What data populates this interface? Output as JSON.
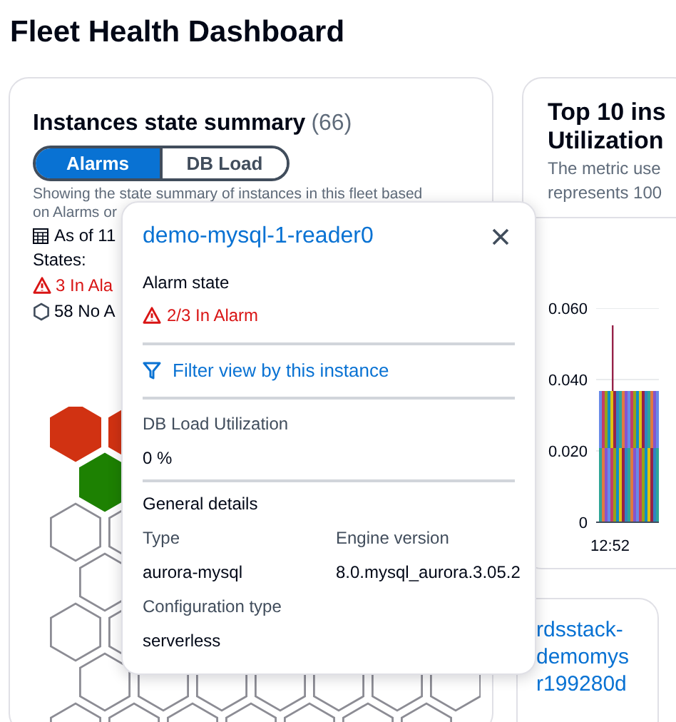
{
  "page_title": "Fleet Health Dashboard",
  "summary_card": {
    "title": "Instances state summary",
    "count": "(66)",
    "tabs": [
      {
        "label": "Alarms",
        "selected": true
      },
      {
        "label": "DB Load",
        "selected": false
      }
    ],
    "description_lines": [
      "Showing the state summary of instances in this fleet based",
      "on Alarms or"
    ],
    "as_of": "As of 11",
    "states_label": "States:",
    "states": [
      {
        "kind": "alarm",
        "text": "3 In Ala"
      },
      {
        "kind": "no_alarm",
        "text": "58 No A"
      }
    ],
    "hex_rows": [
      [
        {
          "color": "#d13212",
          "filled": true
        },
        {
          "color": "#d13212",
          "filled": true
        }
      ],
      [
        {
          "color": "#1d8102",
          "filled": true
        }
      ],
      [
        {
          "color": "#8c8c94",
          "filled": false
        },
        {
          "color": "#8c8c94",
          "filled": false
        }
      ],
      [
        {
          "color": "#8c8c94",
          "filled": false
        }
      ],
      [
        {
          "color": "#8c8c94",
          "filled": false
        },
        {
          "color": "#8c8c94",
          "filled": false
        }
      ],
      [
        {
          "color": "#8c8c94",
          "filled": false
        },
        {
          "color": "#8c8c94",
          "filled": false
        },
        {
          "color": "#8c8c94",
          "filled": false
        },
        {
          "color": "#8c8c94",
          "filled": false
        },
        {
          "color": "#8c8c94",
          "filled": false
        },
        {
          "color": "#8c8c94",
          "filled": false
        },
        {
          "color": "#8c8c94",
          "filled": false
        }
      ],
      [
        {
          "color": "#8c8c94",
          "filled": false
        },
        {
          "color": "#8c8c94",
          "filled": false
        },
        {
          "color": "#8c8c94",
          "filled": false
        },
        {
          "color": "#8c8c94",
          "filled": false
        },
        {
          "color": "#8c8c94",
          "filled": false
        },
        {
          "color": "#8c8c94",
          "filled": false
        },
        {
          "color": "#8c8c94",
          "filled": false
        }
      ]
    ]
  },
  "utilization_card": {
    "title_lines": [
      "Top 10 ins",
      "Utilization"
    ],
    "description_lines": [
      "The metric use",
      "represents 100"
    ],
    "y_labels": [
      "0.060",
      "0.040",
      "0.020",
      "0"
    ],
    "x_label": "12:52"
  },
  "instance_card": {
    "link_lines": [
      "rdsstack-",
      "demomys",
      "r199280d"
    ]
  },
  "popover": {
    "title": "demo-mysql-1-reader0",
    "alarm_label": "Alarm state",
    "alarm_value": "2/3 In Alarm",
    "filter_link": "Filter view by this instance",
    "db_load_label": "DB Load Utilization",
    "db_load_value": "0 %",
    "general_heading": "General details",
    "details": [
      {
        "label": "Type",
        "value": "aurora-mysql"
      },
      {
        "label": "Engine version",
        "value": "8.0.mysql_aurora.3.05.2"
      },
      {
        "label": "Configuration type",
        "value": "serverless"
      }
    ]
  }
}
